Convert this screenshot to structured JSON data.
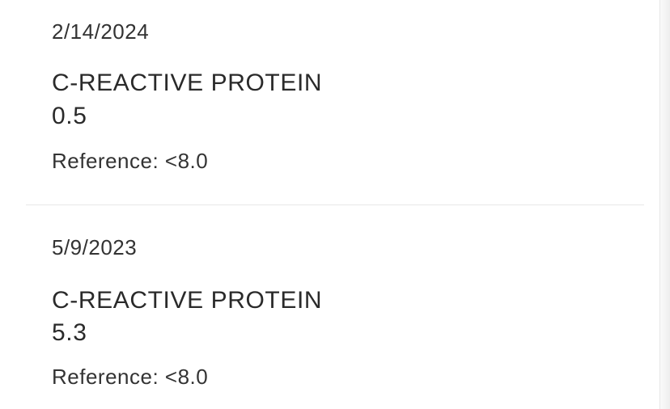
{
  "results": [
    {
      "date": "2/14/2024",
      "test_name": "C-REACTIVE PROTEIN",
      "value": "0.5",
      "reference": "Reference: <8.0"
    },
    {
      "date": "5/9/2023",
      "test_name": "C-REACTIVE PROTEIN",
      "value": "5.3",
      "reference": "Reference: <8.0"
    }
  ]
}
